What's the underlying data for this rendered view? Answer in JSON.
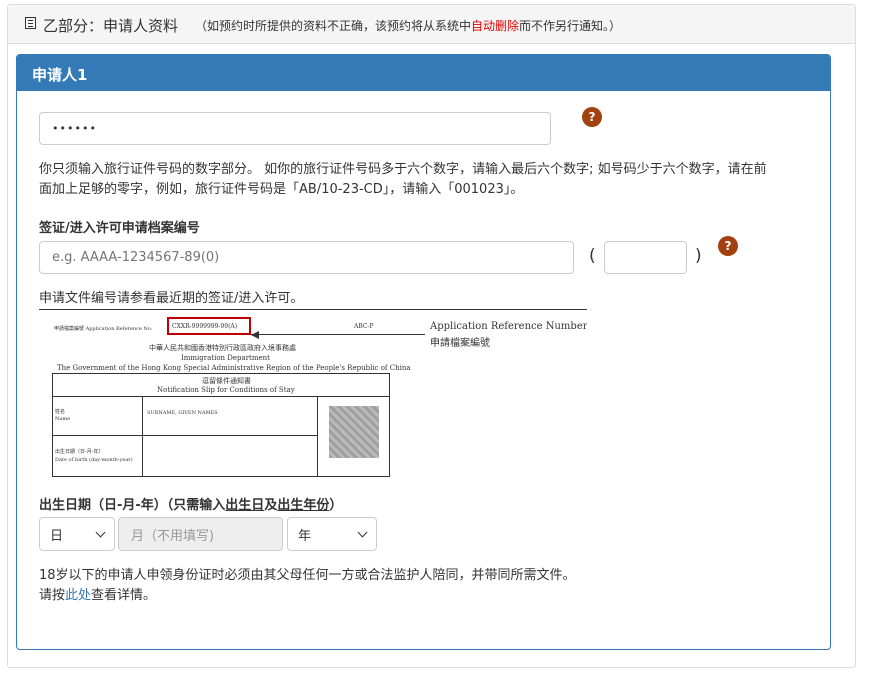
{
  "section": {
    "icon": "list-icon",
    "title": "乙部分：申请人资料",
    "note_prefix": "（如预约时所提供的资料不正确，该预约将从系统中",
    "note_red": "自动删除",
    "note_suffix": "而不作另行通知。）"
  },
  "panel": {
    "title": "申请人1"
  },
  "travel_doc": {
    "value": "••••••",
    "help": "?",
    "hint_line1": "你只须输入旅行证件号码的数字部分。 如你的旅行证件号码多于六个数字，请输入最后六个数字; 如号码少于六个数字，请在前",
    "hint_line2": "面加上足够的零字，例如，旅行证件号码是「AB/10-23-CD」，请输入「001023」。"
  },
  "visa": {
    "label": "签证/进入许可申请档案编号",
    "placeholder": "e.g. AAAA-1234567-89(0)",
    "paren_open": "(",
    "paren_close": ")",
    "help": "?",
    "hint": "申请文件编号请参看最近期的签证/进入许可。"
  },
  "sample_doc": {
    "ref_label": "申請檔案編號 Application Reference No.",
    "ref_value": "CXXR-9999999-99(A)",
    "ref_code": "ABC-P",
    "callout_en": "Application Reference Number",
    "callout_zh": "申請檔案編號",
    "dept_zh": "中華人民共和國香港特別行政區政府入境事務處",
    "dept_en": "Immigration Department",
    "gov_en": "The Government of the Hong Kong Special Administrative Region of the People's Republic of China",
    "slip_zh": "逗留條件通知書",
    "slip_en": "Notification Slip for Conditions of Stay",
    "name_zh": "姓名",
    "name_en": "Name",
    "name_value": "SURNAME, GIVEN NAMES",
    "dob_zh": "出生日期（日-月-年）",
    "dob_en": "Date of birth (day-month-year)"
  },
  "dob": {
    "label_prefix": "出生日期（日-月-年）（只需输入",
    "label_u1": "出生日",
    "label_mid": "及",
    "label_u2": "出生年份",
    "label_suffix": "）",
    "day": "日",
    "month_placeholder": "月（不用填写)",
    "year": "年"
  },
  "notice": {
    "line1": "18岁以下的申请人申领身份证时必须由其父母任何一方或合法监护人陪同，并带同所需文件。",
    "line2_prefix": "请按",
    "line2_link": "此处",
    "line2_suffix": "查看详情。"
  },
  "colors": {
    "panel_blue": "#337ab7",
    "help_brown": "#a0410f",
    "warning_red": "#e00000",
    "sample_highlight": "#c00000"
  }
}
